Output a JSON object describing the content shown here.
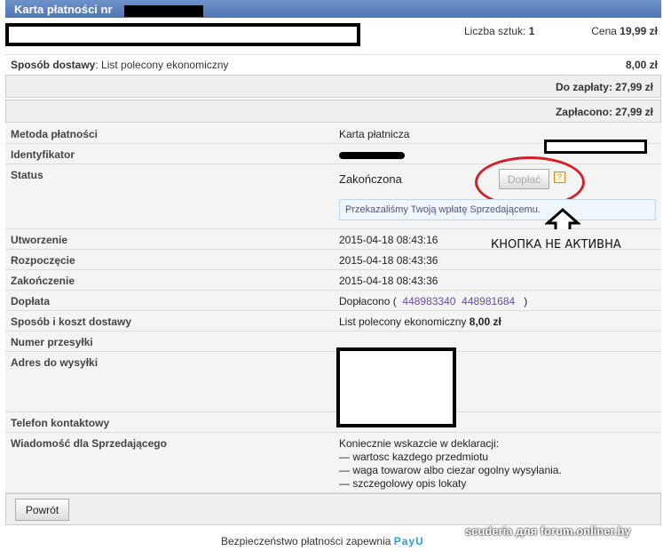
{
  "header": {
    "title": "Karta płatności nr"
  },
  "item": {
    "qty_label": "Liczba sztuk:",
    "qty": "1",
    "price_label": "Cena",
    "price": "19,99 zł"
  },
  "delivery": {
    "label": "Sposób dostawy",
    "value": "List polecony ekonomiczny",
    "cost": "8,00 zł"
  },
  "totals": {
    "to_pay": "Do zapłaty: 27,99 zł",
    "paid": "Zapłacono: 27,99 zł"
  },
  "details": {
    "method_label": "Metoda płatności",
    "method": "Karta płatnicza",
    "id_label": "Identyfikator",
    "status_label": "Status",
    "status": "Zakończona",
    "pay_button": "Dopłać",
    "help": "?",
    "tip": "Przekazaliśmy Twoją wpłatę Sprzedającemu.",
    "annotation": "КНОПКА НЕ АКТИВНА",
    "created_label": "Utworzenie",
    "created": "2015-04-18 08:43:16",
    "started_label": "Rozpoczęcie",
    "started": "2015-04-18 08:43:36",
    "finished_label": "Zakończenie",
    "finished": "2015-04-18 08:43:36",
    "surcharge_label": "Dopłata",
    "surcharge": "Dopłacono (",
    "surcharge_link1": "448983340",
    "surcharge_link2": "448981684",
    "surcharge_close": ")",
    "shipping_label": "Sposób i koszt dostawy",
    "shipping": "List polecony ekonomiczny",
    "shipping_cost": "8,00 zł",
    "tracking_label": "Numer przesyłki",
    "address_label": "Adres do wysyłki",
    "phone_label": "Telefon kontaktowy",
    "message_label": "Wiadomość dla Sprzedającego",
    "message": [
      "Koniecznie wskazcie w deklaracji:",
      "— wartosc kazdego przedmiotu",
      "— waga towarow albo ciezar ogolny wysylania.",
      "— szczegolowy opis lokaty"
    ]
  },
  "footer": {
    "back_button": "Powrót",
    "security": "Bezpieczeństwo płatności zapewnia",
    "brand": "PayU",
    "watermark": "scuderia для forum.onliner.by"
  }
}
